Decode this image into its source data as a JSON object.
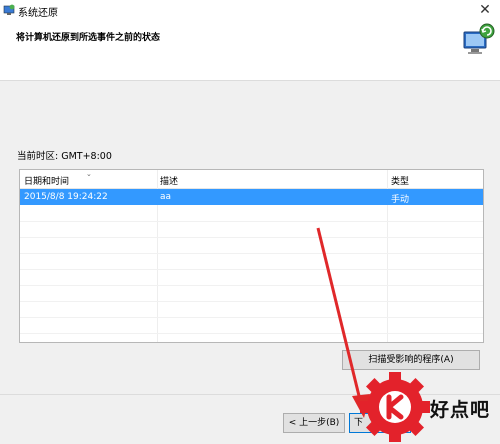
{
  "window": {
    "title": "系统还原",
    "close_glyph": "✕"
  },
  "header": {
    "subtitle": "将计算机还原到所选事件之前的状态"
  },
  "timezone": {
    "label": "当前时区: GMT+8:00"
  },
  "table": {
    "columns": [
      "日期和时间",
      "描述",
      "类型"
    ],
    "rows": [
      {
        "datetime": "2015/8/8 19:24:22",
        "description": "aa",
        "type": "手动"
      }
    ],
    "selected_row": 0
  },
  "buttons": {
    "scan": "扫描受影响的程序(A)",
    "back": "< 上一步(B)",
    "next": "下"
  },
  "watermark": {
    "text": "好点吧"
  },
  "colors": {
    "selection": "#3399ff",
    "arrow": "#e0282a",
    "logo": "#e3222b"
  },
  "icons": [
    "system-restore-icon",
    "close-icon",
    "restore-computer-icon",
    "sort-chevron-icon",
    "watermark-gear-logo"
  ]
}
